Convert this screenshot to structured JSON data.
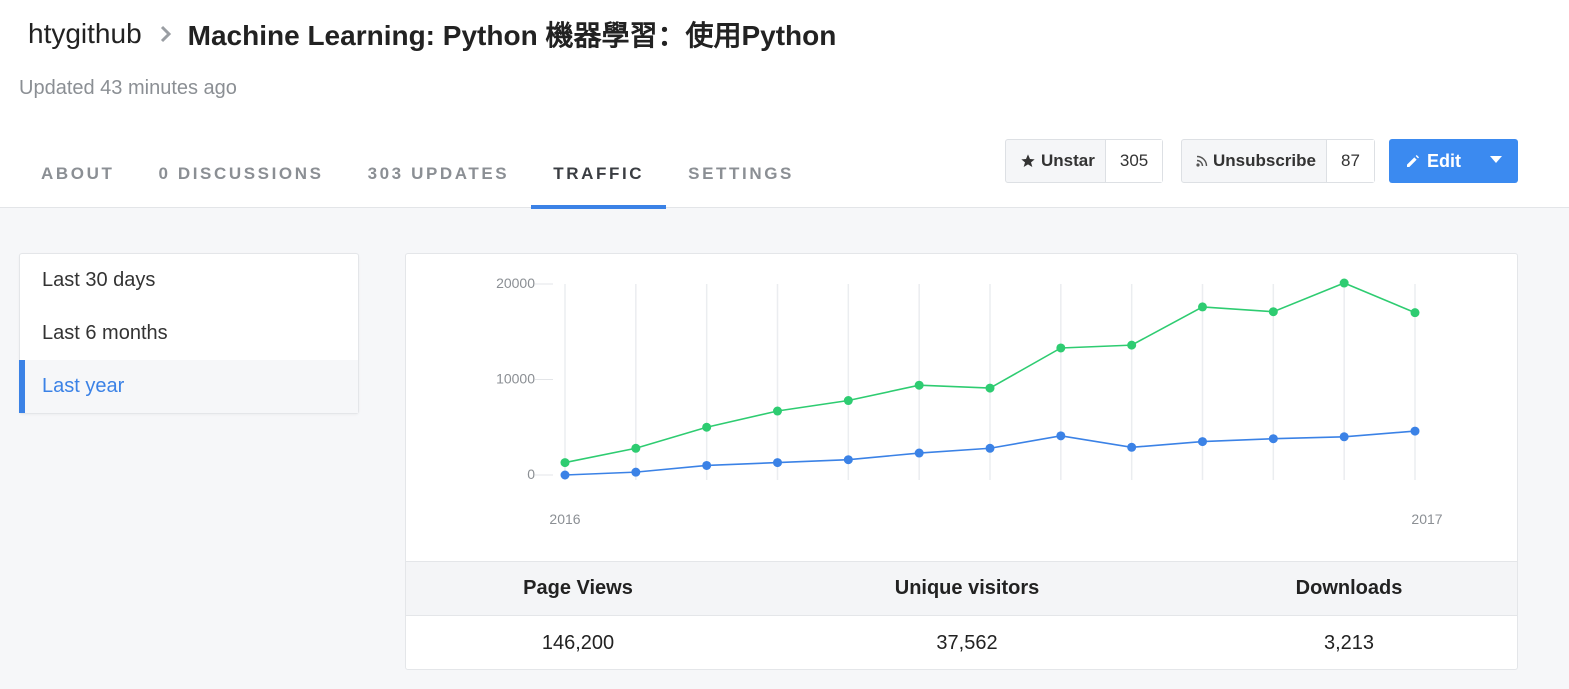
{
  "breadcrumb": {
    "owner": "htygithub",
    "repo": "Machine Learning: Python 機器學習：使用Python"
  },
  "updated": "Updated 43 minutes ago",
  "tabs": [
    {
      "label": "ABOUT",
      "active": false
    },
    {
      "label": "0 DISCUSSIONS",
      "active": false
    },
    {
      "label": "303 UPDATES",
      "active": false
    },
    {
      "label": "TRAFFIC",
      "active": true
    },
    {
      "label": "SETTINGS",
      "active": false
    }
  ],
  "actions": {
    "star": {
      "label": "Unstar",
      "count": "305",
      "icon": "star-icon"
    },
    "subscribe": {
      "label": "Unsubscribe",
      "count": "87",
      "icon": "rss-icon"
    },
    "edit": {
      "label": "Edit",
      "icon": "pencil-icon"
    }
  },
  "sidebar": {
    "items": [
      {
        "label": "Last 30 days",
        "active": false
      },
      {
        "label": "Last 6 months",
        "active": false
      },
      {
        "label": "Last year",
        "active": true
      }
    ]
  },
  "stats": {
    "headers": [
      "Page Views",
      "Unique visitors",
      "Downloads"
    ],
    "values": [
      "146,200",
      "37,562",
      "3,213"
    ]
  },
  "colors": {
    "accent": "#3b82e6",
    "page_views": "#2ecc71",
    "visitors": "#3b82e6"
  },
  "chart_data": {
    "type": "line",
    "x_labels": [
      "2016",
      "2017"
    ],
    "ylim": [
      0,
      20000
    ],
    "y_ticks": [
      0,
      10000,
      20000
    ],
    "grid": "vertical",
    "series": [
      {
        "color": "#2ecc71",
        "values": [
          1300,
          2800,
          5000,
          6700,
          7800,
          9400,
          9100,
          13300,
          13600,
          17600,
          17100,
          20100,
          17000
        ]
      },
      {
        "color": "#3b82e6",
        "values": [
          0,
          300,
          1000,
          1300,
          1600,
          2300,
          2800,
          4100,
          2900,
          3500,
          3800,
          4000,
          4600
        ]
      }
    ]
  }
}
